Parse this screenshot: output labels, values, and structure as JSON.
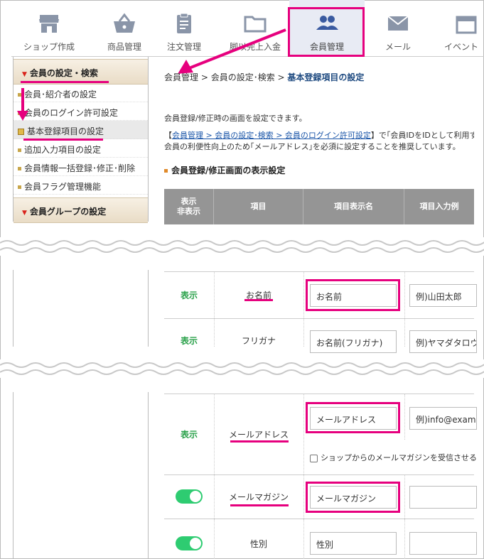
{
  "nav": {
    "items": [
      {
        "label": "ショップ作成",
        "icon": "shop-icon"
      },
      {
        "label": "商品管理",
        "icon": "basket-icon"
      },
      {
        "label": "注文管理",
        "icon": "clipboard-icon"
      },
      {
        "label": "脚以完上入金",
        "icon": "folder-icon"
      },
      {
        "label": "会員管理",
        "icon": "members-icon"
      },
      {
        "label": "メール",
        "icon": "mail-icon"
      },
      {
        "label": "イベント",
        "icon": "event-icon"
      }
    ],
    "active_index": 4
  },
  "sidebar": {
    "section1_title": "会員の設定・検索",
    "items": [
      "会員･紹介者の設定",
      "会員のログイン許可設定",
      "基本登録項目の設定",
      "追加入力項目の設定",
      "会員情報一括登録･修正･削除",
      "会員フラグ管理機能"
    ],
    "active_index": 2,
    "section2_title": "会員グループの設定"
  },
  "breadcrumb": {
    "part1": "会員管理",
    "sep": " > ",
    "part2": "会員の設定･検索",
    "current": "基本登録項目の設定"
  },
  "description": {
    "line1": "会員登録/修正時の画面を設定できます。",
    "line2_open": "【",
    "line2_link": "会員管理 > 会員の設定･検索 > 会員のログイン許可設定",
    "line2_rest": "】で｢会員IDをIDとして利用する｣",
    "line3": "会員の利便性向上のため｢メールアドレス｣を必須に設定することを推奨しています。"
  },
  "section_title": "会員登録/修正画面の表示設定",
  "table": {
    "headers": [
      "表示\n非表示",
      "項目",
      "項目表示名",
      "項目入力例"
    ],
    "rows": [
      {
        "status": "表示",
        "item": "お名前",
        "display_name": "お名前",
        "example": "例)山田太郎"
      },
      {
        "status": "表示",
        "item": "フリガナ",
        "display_name": "お名前(フリガナ)",
        "example": "例)ヤマダタロウ"
      },
      {
        "status": "表示",
        "item": "メールアドレス",
        "display_name": "メールアドレス",
        "example": "例)info@example",
        "checkbox_label": "ショップからのメールマガジンを受信させる"
      },
      {
        "status": "toggle-on",
        "item": "メールマガジン",
        "display_name": "メールマガジン",
        "example": ""
      },
      {
        "status": "toggle-on",
        "item": "性別",
        "display_name": "性別",
        "example": ""
      }
    ]
  },
  "colors": {
    "highlight": "#e6007e",
    "nav_active_bg": "#e8ebf4",
    "show_text": "#2aa14a",
    "toggle_on": "#2ecc71",
    "table_header": "#959595",
    "breadcrumb_current": "#1e4a80"
  }
}
